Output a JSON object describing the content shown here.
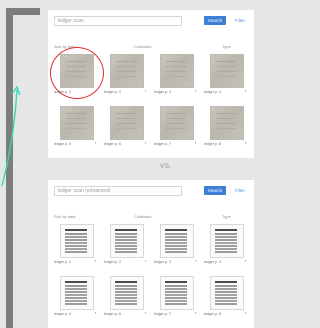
{
  "vs_label": "VS.",
  "colors": {
    "accent": "#3f7fd6",
    "highlight": "#e0302a",
    "arrow": "#3ad6b5",
    "frame": "#7d7d7d"
  },
  "panels": [
    {
      "search_text": "ledger scan",
      "primary_button": "Search",
      "secondary_button": "Filter",
      "headers": [
        "Sort by date",
        "Collection",
        "Type"
      ],
      "tiles": [
        {
          "caption": "ledger p. 1",
          "thumb": "photo",
          "highlighted": true
        },
        {
          "caption": "ledger p. 2",
          "thumb": "photo"
        },
        {
          "caption": "ledger p. 3",
          "thumb": "photo"
        },
        {
          "caption": "ledger p. 4",
          "thumb": "photo"
        },
        {
          "caption": "ledger p. 5",
          "thumb": "photo"
        },
        {
          "caption": "ledger p. 6",
          "thumb": "photo"
        },
        {
          "caption": "ledger p. 7",
          "thumb": "photo"
        },
        {
          "caption": "ledger p. 8",
          "thumb": "photo"
        }
      ]
    },
    {
      "search_text": "ledger scan (enhanced)",
      "primary_button": "Search",
      "secondary_button": "Filter",
      "headers": [
        "Sort by date",
        "Collection",
        "Type"
      ],
      "tiles": [
        {
          "caption": "ledger p. 1",
          "thumb": "doc"
        },
        {
          "caption": "ledger p. 2",
          "thumb": "doc"
        },
        {
          "caption": "ledger p. 3",
          "thumb": "doc"
        },
        {
          "caption": "ledger p. 4",
          "thumb": "doc"
        },
        {
          "caption": "ledger p. 5",
          "thumb": "doc"
        },
        {
          "caption": "ledger p. 6",
          "thumb": "doc"
        },
        {
          "caption": "ledger p. 7",
          "thumb": "doc"
        },
        {
          "caption": "ledger p. 8",
          "thumb": "doc"
        }
      ]
    }
  ]
}
